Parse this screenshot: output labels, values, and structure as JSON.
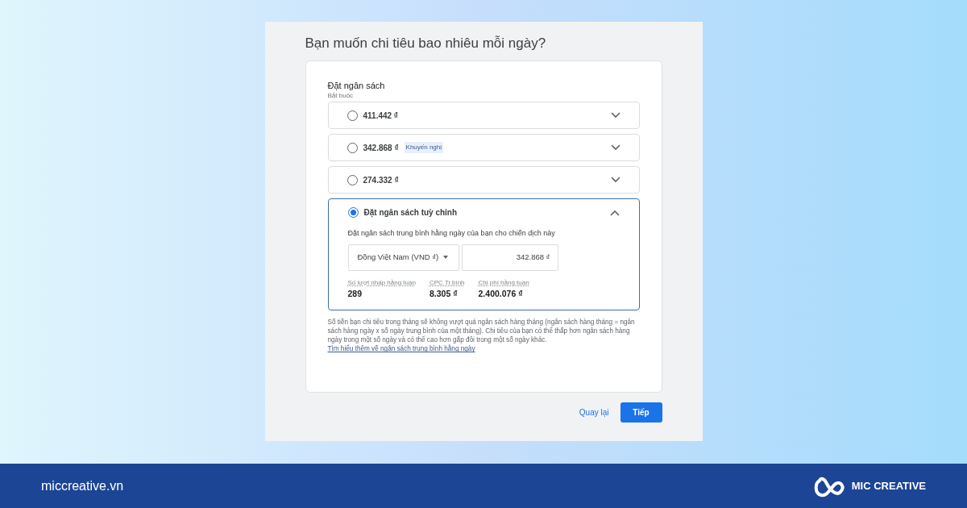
{
  "page_title": "Bạn muốn chi tiêu bao nhiêu mỗi ngày?",
  "budget": {
    "label": "Đặt ngân sách",
    "hint": "Bắt buộc",
    "options": [
      {
        "label": "411.442 ₫",
        "selected": false,
        "expanded": false
      },
      {
        "label": "342.868 ₫",
        "badge": "Khuyến nghị",
        "selected": false,
        "expanded": false
      },
      {
        "label": "274.332 ₫",
        "selected": false,
        "expanded": false
      },
      {
        "label": "Đặt ngân sách tuỳ chỉnh",
        "selected": true,
        "expanded": true,
        "description": "Đặt ngân sách trung bình hằng ngày của bạn cho chiến dịch này",
        "currency": "Đồng Việt Nam (VND ₫)",
        "amount": "342.868 ₫",
        "stats": [
          {
            "label": "Số lượt nhấp hằng tuần",
            "value": "289"
          },
          {
            "label": "CPC Tr.bình",
            "value": "8.305 ₫"
          },
          {
            "label": "Chi phí hằng tuần",
            "value": "2.400.076 ₫"
          }
        ]
      }
    ],
    "note": "Số tiền bạn chi tiêu trong tháng sẽ không vượt quá ngân sách hàng tháng (ngân sách hàng tháng = ngân sách hàng ngày x số ngày trung bình của một tháng). Chi tiêu của bạn có thể thấp hơn ngân sách hàng ngày trong một số ngày và có thể cao hơn gấp đôi trong một số ngày khác.",
    "note_link": "Tìm hiểu thêm về ngân sách trung bình hằng ngày"
  },
  "buttons": {
    "back": "Quay lại",
    "next": "Tiếp"
  },
  "footer": {
    "website": "miccreative.vn",
    "brand": "MIC CREATIVE"
  }
}
